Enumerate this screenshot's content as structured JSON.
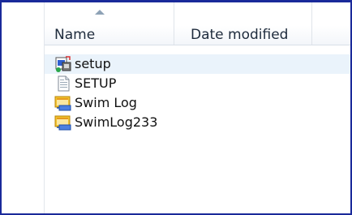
{
  "columns": {
    "name": "Name",
    "date_modified": "Date modified"
  },
  "files": [
    {
      "label": "setup",
      "icon": "installer-icon"
    },
    {
      "label": "SETUP",
      "icon": "text-file-icon"
    },
    {
      "label": "Swim Log",
      "icon": "database-file-icon"
    },
    {
      "label": "SwimLog233",
      "icon": "database-file-icon"
    }
  ],
  "colors": {
    "frame_border": "#1a2a9a",
    "selection": "#eaf3fb"
  }
}
